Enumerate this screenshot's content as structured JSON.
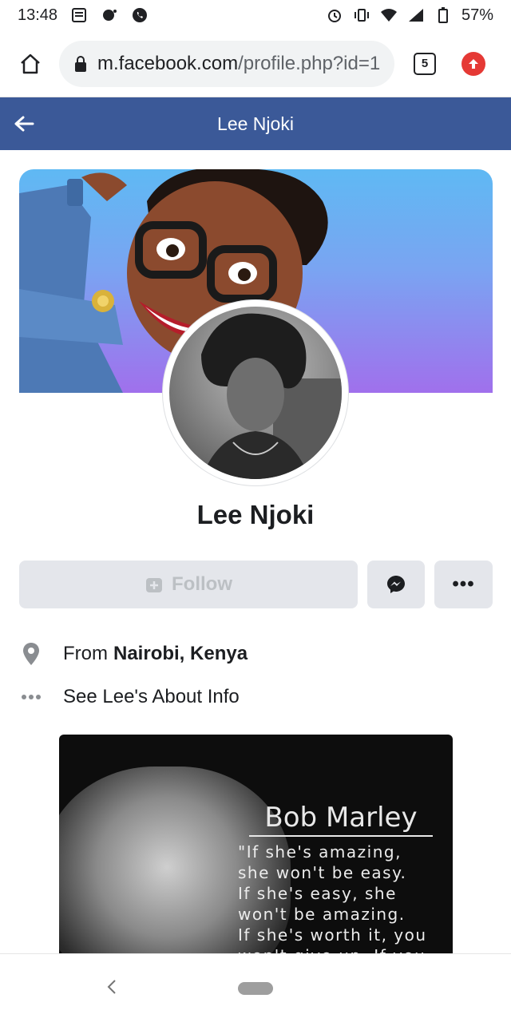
{
  "status_bar": {
    "time": "13:48",
    "battery": "57%"
  },
  "browser": {
    "url_host": "m.facebook.com",
    "url_path": "/profile.php?id=1",
    "tab_count": "5"
  },
  "header": {
    "title": "Lee Njoki"
  },
  "profile": {
    "name": "Lee Njoki",
    "follow_label": "Follow",
    "more_label": "•••"
  },
  "info": {
    "from_prefix": "From",
    "from_place": "Nairobi, Kenya",
    "about_link": "See Lee's About Info"
  },
  "featured": {
    "quote_title": "Bob Marley",
    "quote_text": "\"If she's amazing,\nshe won't be easy.\nIf she's easy, she\nwon't be amazing.\nIf she's worth it, you\nwon't give up. If you"
  },
  "colors": {
    "fb_blue": "#3b5998",
    "button_gray": "#e4e6eb",
    "update_red": "#e53935"
  },
  "icons": {
    "home": "home-icon",
    "lock": "lock-icon",
    "back": "arrow-left-icon",
    "messenger": "messenger-icon",
    "location": "location-pin-icon",
    "more": "more-dots-icon"
  }
}
